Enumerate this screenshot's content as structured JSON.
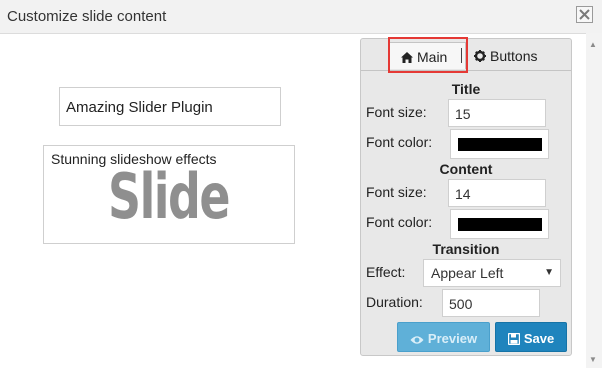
{
  "window": {
    "title": "Customize slide content"
  },
  "slide": {
    "title_text": "Amazing Slider Plugin",
    "content_text": "Stunning slideshow effects",
    "watermark": "Slide"
  },
  "panel": {
    "tabs": [
      {
        "label": "Main",
        "icon": "home-icon"
      },
      {
        "label": "Buttons",
        "icon": "gear-icon"
      }
    ],
    "title_section": {
      "heading": "Title",
      "font_size_label": "Font size:",
      "font_size": "15",
      "font_color_label": "Font color:",
      "font_color": "#000000"
    },
    "content_section": {
      "heading": "Content",
      "font_size_label": "Font size:",
      "font_size": "14",
      "font_color_label": "Font color:",
      "font_color": "#000000"
    },
    "transition_section": {
      "heading": "Transition",
      "effect_label": "Effect:",
      "effect_value": "Appear Left",
      "duration_label": "Duration:",
      "duration_value": "500"
    },
    "buttons": {
      "preview": "Preview",
      "save": "Save"
    }
  },
  "colors": {
    "highlight": "#e53935",
    "save_button": "#1f84bd",
    "preview_button": "#5fb0d8"
  }
}
